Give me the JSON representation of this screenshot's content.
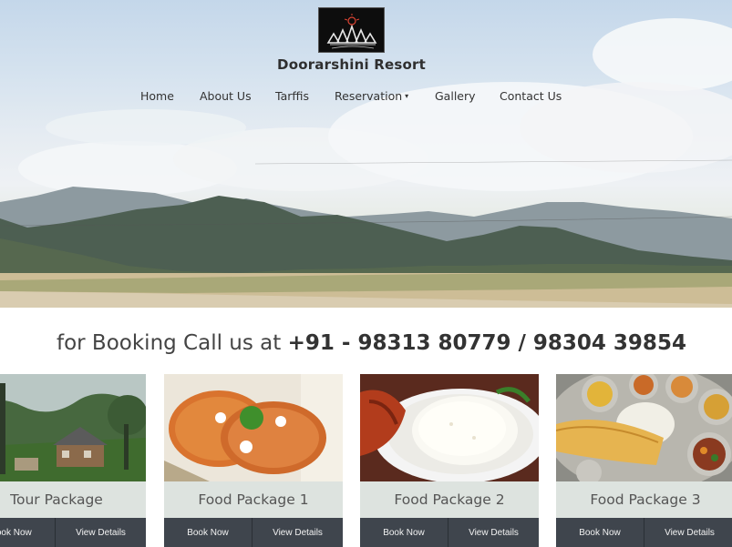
{
  "header": {
    "brand": "Doorarshini Resort",
    "logo_icon": "resort-logo-icon"
  },
  "nav": {
    "items": [
      {
        "label": "Home"
      },
      {
        "label": "About Us"
      },
      {
        "label": "Tarffis"
      },
      {
        "label": "Reservation",
        "has_dropdown": true
      },
      {
        "label": "Gallery"
      },
      {
        "label": "Contact Us"
      }
    ],
    "dropdown_caret": "▾"
  },
  "booking": {
    "prefix": "for Booking Call us at ",
    "phones": "+91 - 98313 80779 / 98304 39854"
  },
  "packages": [
    {
      "title": "Tour Package",
      "book_label": "Book Now",
      "view_label": "View Details"
    },
    {
      "title": "Food Package 1",
      "book_label": "Book Now",
      "view_label": "View Details"
    },
    {
      "title": "Food Package 2",
      "book_label": "Book Now",
      "view_label": "View Details"
    },
    {
      "title": "Food Package 3",
      "book_label": "Book Now",
      "view_label": "View Details"
    }
  ],
  "colors": {
    "button_bg": "#3f454d",
    "title_bg": "#dde3df",
    "text_dark": "#333333"
  }
}
